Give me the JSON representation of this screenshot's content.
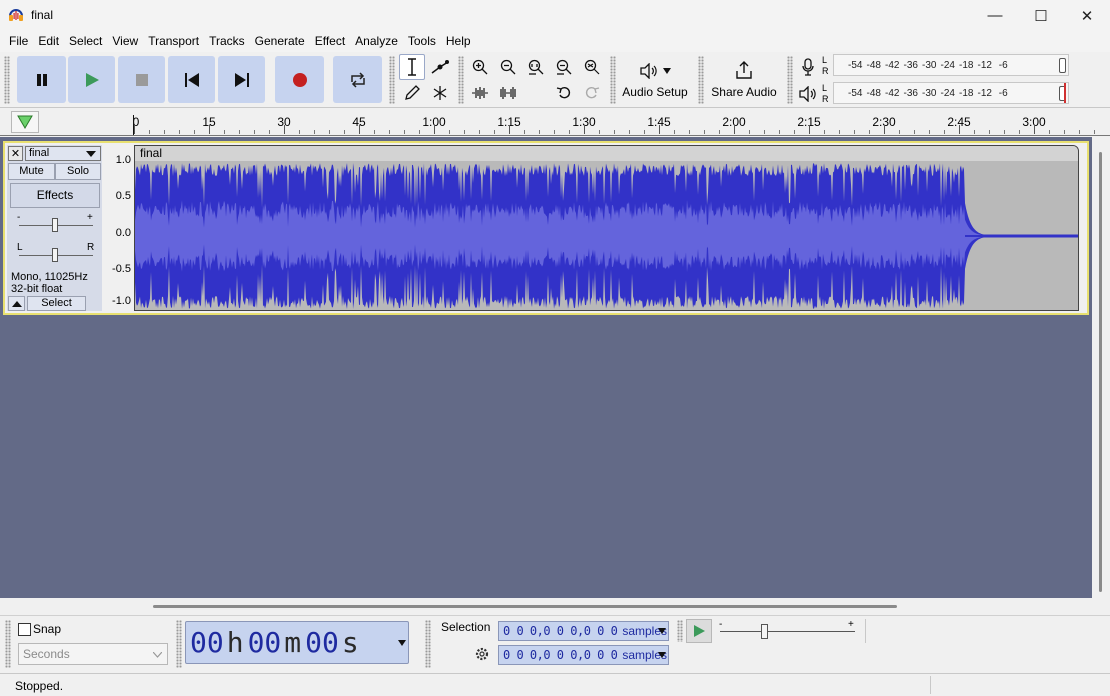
{
  "window": {
    "title": "final",
    "minimize_glyph": "—",
    "maximize_glyph": "☐",
    "close_glyph": "✕"
  },
  "menu": [
    "File",
    "Edit",
    "Select",
    "View",
    "Transport",
    "Tracks",
    "Generate",
    "Effect",
    "Analyze",
    "Tools",
    "Help"
  ],
  "toolbar": {
    "audio_setup_label": "Audio Setup",
    "share_audio_label": "Share Audio",
    "meter_channels": [
      "L",
      "R"
    ],
    "meter_scale": [
      "-54",
      "-48",
      "-42",
      "-36",
      "-30",
      "-24",
      "-18",
      "-12",
      "-6"
    ]
  },
  "ruler": {
    "ticks": [
      "0",
      "15",
      "30",
      "45",
      "1:00",
      "1:15",
      "1:30",
      "1:45",
      "2:00",
      "2:15",
      "2:30",
      "2:45",
      "3:00"
    ]
  },
  "track": {
    "name": "final",
    "close_glyph": "✕",
    "mute": "Mute",
    "solo": "Solo",
    "effects": "Effects",
    "gain_minus": "-",
    "gain_plus": "+",
    "pan_left": "L",
    "pan_right": "R",
    "format_line1": "Mono, 11025Hz",
    "format_line2": "32-bit float",
    "select": "Select",
    "clip_name": "final",
    "y_labels": [
      "1.0",
      "0.5",
      "0.0",
      "-0.5",
      "-1.0"
    ]
  },
  "bottom": {
    "snap_label": "Snap",
    "snap_checked": false,
    "snap_unit": "Seconds",
    "timer": {
      "h": "00",
      "h_unit": "h",
      "m": "00",
      "m_unit": "m",
      "s": "00",
      "s_unit": "s"
    },
    "selection_label": "Selection",
    "selection_start": "0 0 0,0 0 0,0 0 0",
    "selection_end": "0 0 0,0 0 0,0 0 0",
    "selection_unit": "samples",
    "speed_minus": "-",
    "speed_plus": "+"
  },
  "status": {
    "text": "Stopped."
  },
  "colors": {
    "accent_button": "#c6d3ef",
    "waveform": "#3232c8",
    "waveform_rms": "#6464dc",
    "track_background": "#636a87",
    "track_selected_border": "#e8e070"
  }
}
